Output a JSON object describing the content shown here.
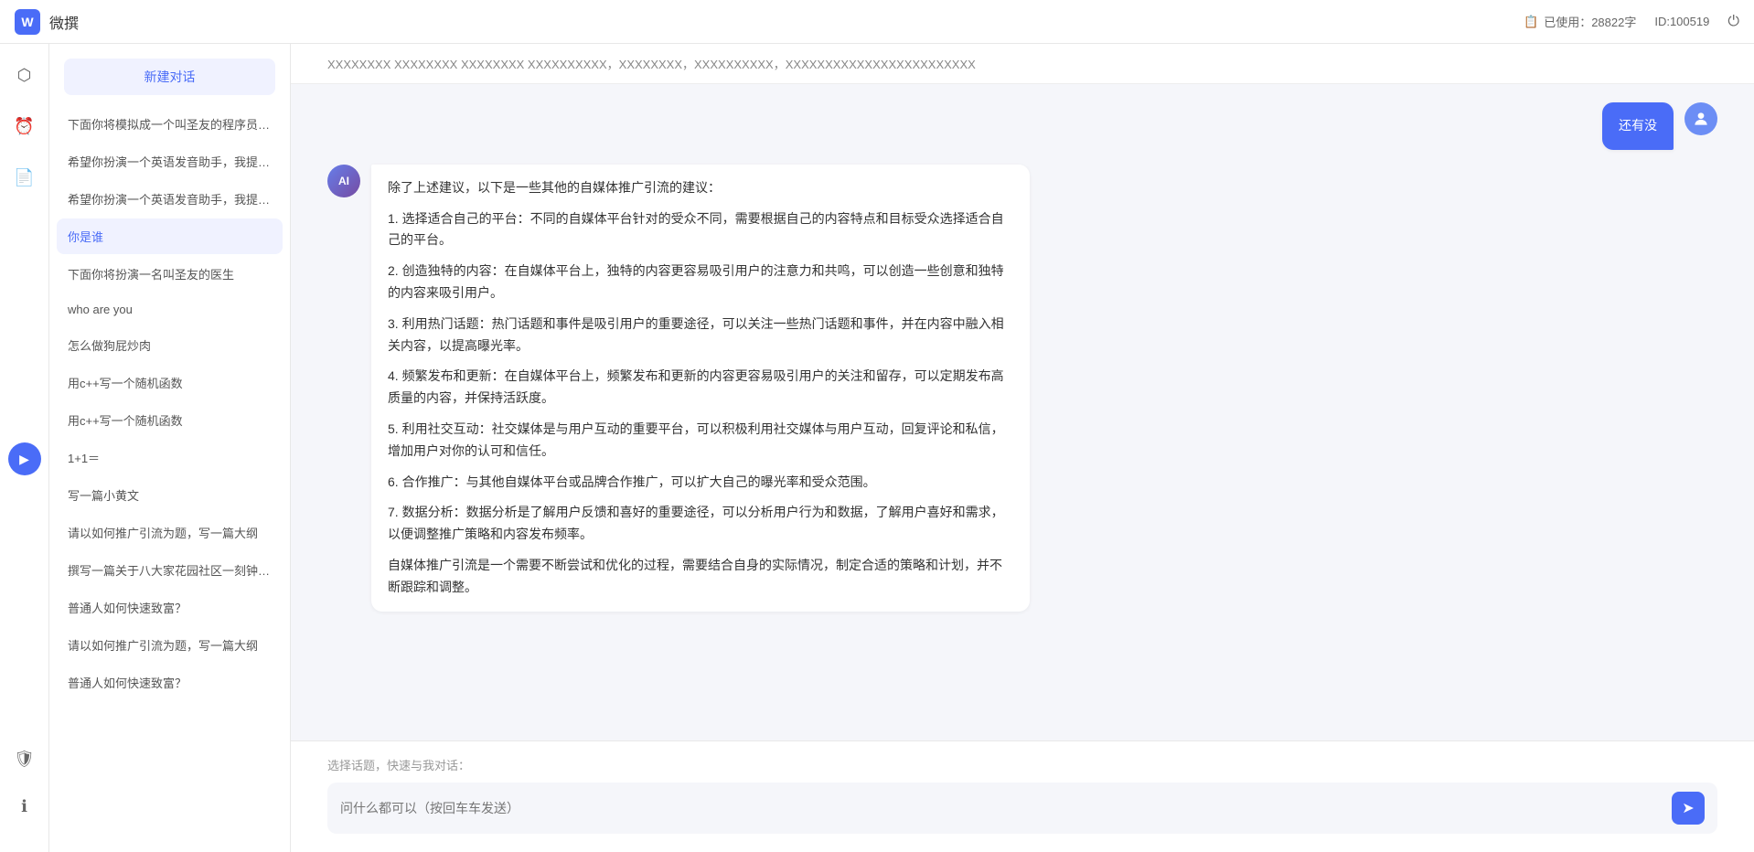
{
  "app": {
    "title": "微撰",
    "logo_text": "W",
    "usage_label": "已使用：28822字",
    "id_label": "ID:100519"
  },
  "topbar": {
    "usage_icon": "📋",
    "power_icon": "⏻"
  },
  "icon_sidebar": {
    "items": [
      {
        "name": "cube-icon",
        "symbol": "⬡"
      },
      {
        "name": "clock-icon",
        "symbol": "⏰"
      },
      {
        "name": "document-icon",
        "symbol": "📄"
      }
    ],
    "arrow_symbol": "▶",
    "bottom_items": [
      {
        "name": "shield-icon",
        "symbol": "🛡"
      },
      {
        "name": "info-icon",
        "symbol": "ℹ"
      }
    ]
  },
  "conv_sidebar": {
    "new_btn_label": "新建对话",
    "conversations": [
      {
        "id": 1,
        "text": "下面你将模拟成一个叫圣友的程序员，我说..."
      },
      {
        "id": 2,
        "text": "希望你扮演一个英语发音助手，我提供给你..."
      },
      {
        "id": 3,
        "text": "希望你扮演一个英语发音助手，我提供给你..."
      },
      {
        "id": 4,
        "text": "你是谁",
        "active": true
      },
      {
        "id": 5,
        "text": "下面你将扮演一名叫圣友的医生"
      },
      {
        "id": 6,
        "text": "who are you"
      },
      {
        "id": 7,
        "text": "怎么做狗屁炒肉"
      },
      {
        "id": 8,
        "text": "用c++写一个随机函数"
      },
      {
        "id": 9,
        "text": "用c++写一个随机函数"
      },
      {
        "id": 10,
        "text": "1+1＝"
      },
      {
        "id": 11,
        "text": "写一篇小黄文"
      },
      {
        "id": 12,
        "text": "请以如何推广引流为题，写一篇大纲"
      },
      {
        "id": 13,
        "text": "撰写一篇关于八大家花园社区一刻钟便民生..."
      },
      {
        "id": 14,
        "text": "普通人如何快速致富？"
      },
      {
        "id": 15,
        "text": "请以如何推广引流为题，写一篇大纲"
      },
      {
        "id": 16,
        "text": "普通人如何快速致富？"
      }
    ]
  },
  "chat": {
    "top_truncated_text": "XXXXXXXX XXXXXXXX XXXXXXXX  XXXXXXXXXX，XXXXXXXX，XXXXXXXXXX，XXXXXXXXXXXXXXXXXXXXXXXX",
    "messages": [
      {
        "role": "user",
        "avatar_text": "U",
        "text": "还有没"
      },
      {
        "role": "assistant",
        "avatar_text": "AI",
        "content": [
          "除了上述建议，以下是一些其他的自媒体推广引流的建议：",
          "1. 选择适合自己的平台：不同的自媒体平台针对的受众不同，需要根据自己的内容特点和目标受众选择适合自己的平台。",
          "2. 创造独特的内容：在自媒体平台上，独特的内容更容易吸引用户的注意力和共鸣，可以创造一些创意和独特的内容来吸引用户。",
          "3. 利用热门话题：热门话题和事件是吸引用户的重要途径，可以关注一些热门话题和事件，并在内容中融入相关内容，以提高曝光率。",
          "4. 频繁发布和更新：在自媒体平台上，频繁发布和更新的内容更容易吸引用户的关注和留存，可以定期发布高质量的内容，并保持活跃度。",
          "5. 利用社交互动：社交媒体是与用户互动的重要平台，可以积极利用社交媒体与用户互动，回复评论和私信，增加用户对你的认可和信任。",
          "6. 合作推广：与其他自媒体平台或品牌合作推广，可以扩大自己的曝光率和受众范围。",
          "7. 数据分析：数据分析是了解用户反馈和喜好的重要途径，可以分析用户行为和数据，了解用户喜好和需求，以便调整推广策略和内容发布频率。",
          "自媒体推广引流是一个需要不断尝试和优化的过程，需要结合自身的实际情况，制定合适的策略和计划，并不断跟踪和调整。"
        ]
      }
    ],
    "input_placeholder": "问什么都可以（按回车车发送）",
    "quick_topic_label": "选择话题，快速与我对话：",
    "send_icon": "➤"
  }
}
